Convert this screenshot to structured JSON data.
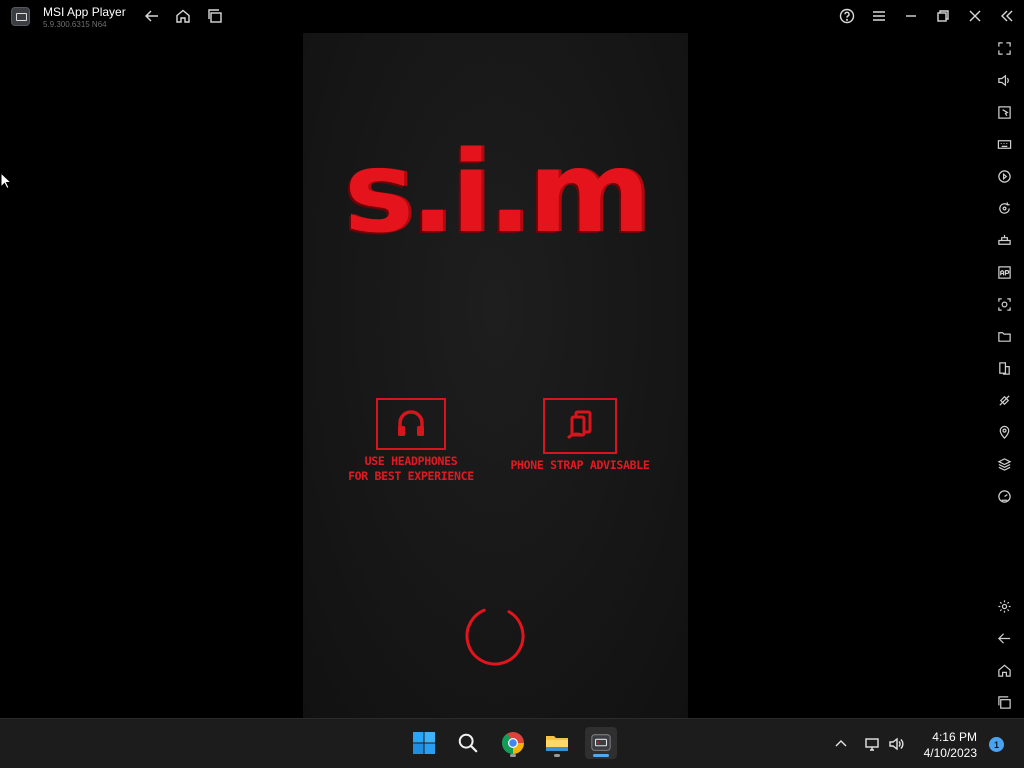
{
  "window": {
    "title": "MSI App Player",
    "version": "5.9.300.6315  N64"
  },
  "titlebar_buttons": [
    "back-icon",
    "home-icon",
    "recent-apps-icon",
    "help-icon",
    "menu-icon",
    "minimize-icon",
    "restore-icon",
    "close-icon",
    "collapse-sidebar-icon"
  ],
  "sidebar": {
    "top_items": [
      "fullscreen-icon",
      "volume-icon",
      "pointer-icon",
      "keyboard-icon",
      "macro-icon",
      "rotate-sync-icon",
      "gamepad-icon",
      "apk-icon",
      "screenshot-icon",
      "folder-icon",
      "multi-instance-icon",
      "eco-mode-icon",
      "location-icon",
      "layers-icon",
      "performance-icon"
    ],
    "bottom_items": [
      "settings-icon",
      "android-back-icon",
      "android-home-icon",
      "android-recents-icon"
    ]
  },
  "game": {
    "logo": "s.i.m",
    "tips": [
      {
        "icon": "headphones-icon",
        "line1": "USE HEADPHONES",
        "line2": "FOR BEST EXPERIENCE"
      },
      {
        "icon": "phone-strap-icon",
        "line1": "PHONE STRAP ADVISABLE",
        "line2": ""
      }
    ],
    "loading": "spinner-icon",
    "accent_color": "#e5141c",
    "background_color": "#151515"
  },
  "taskbar": {
    "apps": [
      "windows-start-icon",
      "search-icon",
      "chrome-icon",
      "file-explorer-icon",
      "msi-app-player-icon"
    ],
    "tray": [
      "chevron-up-icon",
      "network-icon",
      "volume-icon"
    ],
    "time": "4:16 PM",
    "date": "4/10/2023",
    "notification_count": "1"
  }
}
